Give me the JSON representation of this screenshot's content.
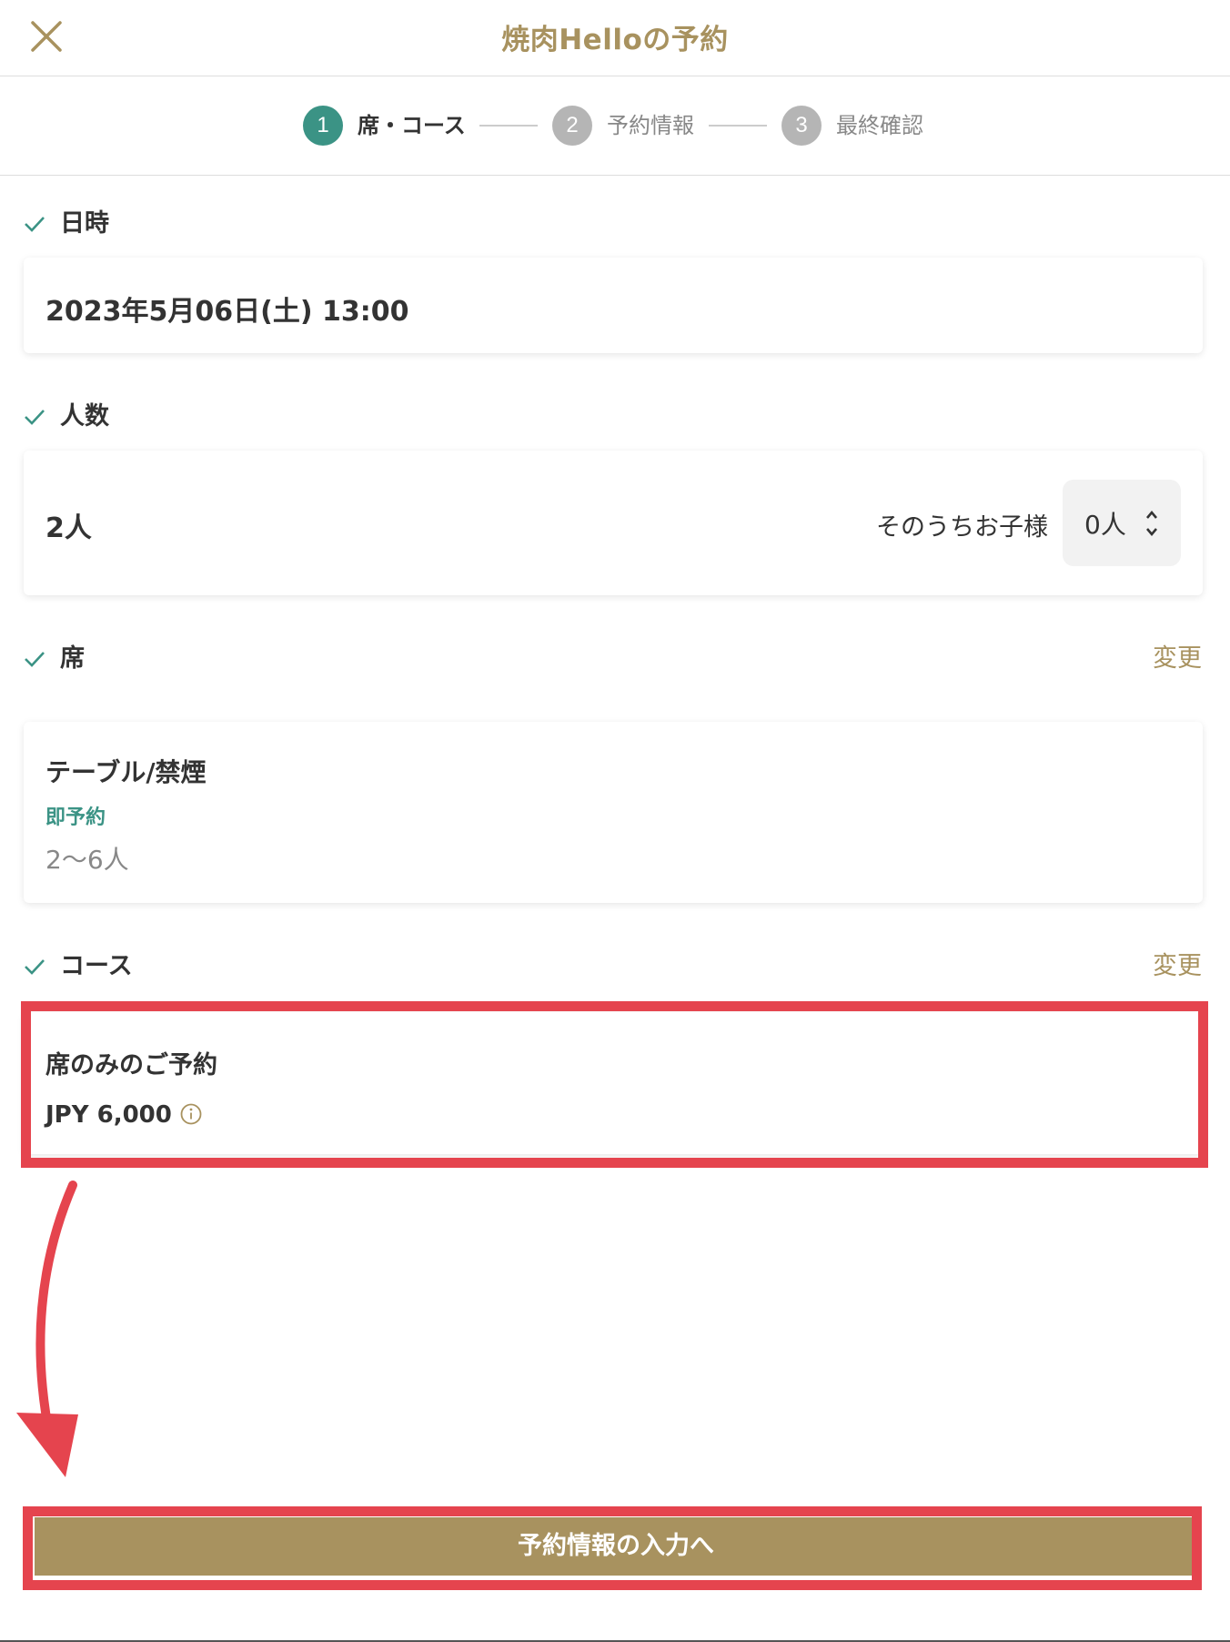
{
  "header": {
    "title": "焼肉Helloの予約",
    "close_icon": "close-icon"
  },
  "steps": [
    {
      "number": "1",
      "label": "席・コース",
      "active": true
    },
    {
      "number": "2",
      "label": "予約情報",
      "active": false
    },
    {
      "number": "3",
      "label": "最終確認",
      "active": false
    }
  ],
  "datetime": {
    "title": "日時",
    "value": "2023年5月06日(土) 13:00"
  },
  "party": {
    "title": "人数",
    "count": "2人",
    "children_label": "そのうちお子様",
    "children_value": "0人"
  },
  "seat": {
    "title": "席",
    "change_label": "変更",
    "name": "テーブル/禁煙",
    "badge": "即予約",
    "capacity": "2〜6人"
  },
  "course": {
    "title": "コース",
    "change_label": "変更",
    "name": "席のみのご予約",
    "price": "JPY 6,000"
  },
  "cta": {
    "label": "予約情報の入力へ"
  },
  "colors": {
    "accent": "#a8925f",
    "step_active": "#3b9385",
    "step_inactive": "#b5b5b5",
    "highlight": "#e5444e"
  }
}
